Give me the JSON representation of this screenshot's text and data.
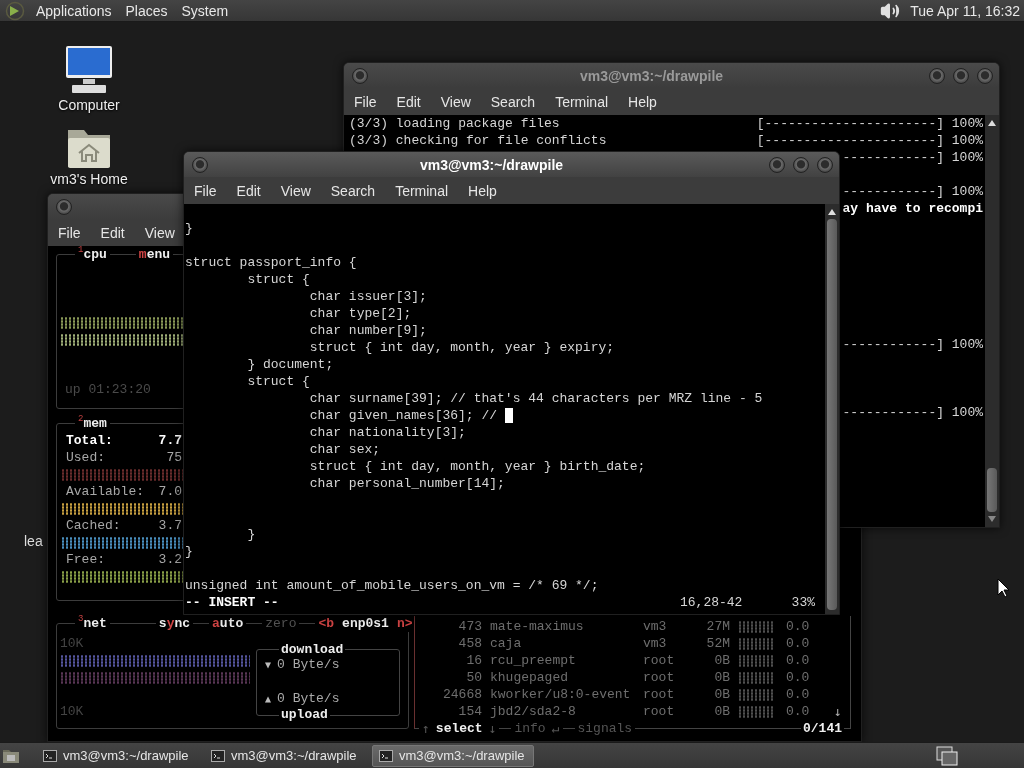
{
  "top_panel": {
    "menus": [
      "Applications",
      "Places",
      "System"
    ],
    "clock": "Tue Apr 11, 16:32"
  },
  "desktop_icons": [
    {
      "kind": "computer",
      "label": "Computer"
    },
    {
      "kind": "home",
      "label": "vm3's Home"
    }
  ],
  "partial_icon_label": "lea",
  "pacman_terminal": {
    "title": "vm3@vm3:~/drawpile",
    "active": false,
    "menus": [
      "File",
      "Edit",
      "View",
      "Search",
      "Terminal",
      "Help"
    ],
    "lines": [
      {
        "kind": "progress",
        "text": "(3/3) loading package files",
        "bar": "[----------------------] 100%"
      },
      {
        "kind": "progress",
        "text": "(3/3) checking for file conflicts",
        "bar": "[----------------------] 100%"
      },
      {
        "kind": "tail",
        "text": "------------] 100%"
      },
      {
        "kind": "blank"
      },
      {
        "kind": "tail",
        "text": "------------] 100%"
      },
      {
        "kind": "message",
        "text": "ay have to recompi"
      },
      {
        "kind": "blank"
      },
      {
        "kind": "blank"
      },
      {
        "kind": "blank"
      },
      {
        "kind": "blank"
      },
      {
        "kind": "blank"
      },
      {
        "kind": "blank"
      },
      {
        "kind": "blank"
      },
      {
        "kind": "tail",
        "text": "------------] 100%"
      },
      {
        "kind": "blank"
      },
      {
        "kind": "blank"
      },
      {
        "kind": "blank"
      },
      {
        "kind": "tail",
        "text": "------------] 100%"
      }
    ]
  },
  "btop_terminal": {
    "active": false,
    "menus": [
      "File",
      "Edit",
      "View"
    ],
    "cpu": {
      "number": "1",
      "title": "cpu",
      "menu_toggle": [
        {
          "text": "m",
          "kind": "hot"
        },
        {
          "text": "enu",
          "kind": "bright"
        }
      ],
      "uptime": "up 01:23:20"
    },
    "mem": {
      "number": "2",
      "title": "mem",
      "rows": [
        {
          "kind": "total",
          "label": "Total:",
          "value": "7.7"
        },
        {
          "kind": "meter",
          "label": "Used:",
          "value": "75",
          "color": "#6a2c2c"
        },
        {
          "kind": "meter",
          "label": "Available:",
          "value": "7.0",
          "color": "#c8a040"
        },
        {
          "kind": "meter",
          "label": "Cached:",
          "value": "3.7",
          "color": "#4a90c0"
        },
        {
          "kind": "meter",
          "label": "Free:",
          "value": "3.2",
          "color": "#8aa048"
        }
      ]
    },
    "net": {
      "number": "3",
      "title": "net",
      "toggles": [
        [
          {
            "text": "s",
            "kind": "bright"
          },
          {
            "text": "y",
            "kind": "hot"
          },
          {
            "text": "nc",
            "kind": "bright"
          }
        ],
        [
          {
            "text": "a",
            "kind": "hot"
          },
          {
            "text": "uto",
            "kind": "bright"
          }
        ],
        [
          {
            "text": "zero",
            "kind": "dim"
          }
        ]
      ],
      "interface": {
        "prev": "<b",
        "name": "enp0s1",
        "next": "n>"
      },
      "scale_top": "10K",
      "scale_bottom": "10K",
      "download": {
        "label": "download",
        "arrow": "▼",
        "rate": "0 Byte/s"
      },
      "upload": {
        "label": "upload",
        "arrow": "▲",
        "rate": "0 Byte/s"
      }
    },
    "processes": {
      "rows": [
        {
          "pid": "473",
          "name": "mate-maximus",
          "user": "vm3",
          "mem": "27M",
          "cpu": "0.0"
        },
        {
          "pid": "458",
          "name": "caja",
          "user": "vm3",
          "mem": "52M",
          "cpu": "0.0"
        },
        {
          "pid": "16",
          "name": "rcu_preempt",
          "user": "root",
          "mem": "0B",
          "cpu": "0.0"
        },
        {
          "pid": "50",
          "name": "khugepaged",
          "user": "root",
          "mem": "0B",
          "cpu": "0.0"
        },
        {
          "pid": "24668",
          "name": "kworker/u8:0-event",
          "user": "root",
          "mem": "0B",
          "cpu": "0.0"
        },
        {
          "pid": "154",
          "name": "jbd2/sda2-8",
          "user": "root",
          "mem": "0B",
          "cpu": "0.0"
        }
      ],
      "scroll_arrow": "↓",
      "footer": [
        [
          {
            "text": "↑",
            "kind": "dim"
          },
          {
            "text": "select",
            "kind": "bright"
          },
          {
            "text": "↓",
            "kind": "dim"
          }
        ],
        [
          {
            "text": "info",
            "kind": "dim"
          },
          {
            "text": "↵",
            "kind": "dim"
          }
        ],
        [
          {
            "text": "signals",
            "kind": "dim"
          }
        ]
      ],
      "count": "0/141"
    }
  },
  "vim_terminal": {
    "title": "vm3@vm3:~/drawpile",
    "active": true,
    "menus": [
      "File",
      "Edit",
      "View",
      "Search",
      "Terminal",
      "Help"
    ],
    "lines": [
      {
        "kind": "code",
        "text": "}",
        "cursor": false
      },
      {
        "kind": "blank"
      },
      {
        "kind": "code",
        "text": "struct passport_info {",
        "cursor": false
      },
      {
        "kind": "code",
        "text": "        struct {",
        "cursor": false
      },
      {
        "kind": "code",
        "text": "                char issuer[3];",
        "cursor": false
      },
      {
        "kind": "code",
        "text": "                char type[2];",
        "cursor": false
      },
      {
        "kind": "code",
        "text": "                char number[9];",
        "cursor": false
      },
      {
        "kind": "code",
        "text": "                struct { int day, month, year } expiry;",
        "cursor": false
      },
      {
        "kind": "code",
        "text": "        } document;",
        "cursor": false
      },
      {
        "kind": "code",
        "text": "        struct {",
        "cursor": false
      },
      {
        "kind": "code",
        "text": "                char surname[39]; // that's 44 characters per MRZ line - 5",
        "cursor": false
      },
      {
        "kind": "code",
        "text": "                char given_names[36]; // ",
        "cursor": true
      },
      {
        "kind": "code",
        "text": "                char nationality[3];",
        "cursor": false
      },
      {
        "kind": "code",
        "text": "                char sex;",
        "cursor": false
      },
      {
        "kind": "code",
        "text": "                struct { int day, month, year } birth_date;",
        "cursor": false
      },
      {
        "kind": "code",
        "text": "                char personal_number[14];",
        "cursor": false
      },
      {
        "kind": "blank"
      },
      {
        "kind": "blank"
      },
      {
        "kind": "code",
        "text": "        }",
        "cursor": false
      },
      {
        "kind": "code",
        "text": "}",
        "cursor": false
      },
      {
        "kind": "blank"
      },
      {
        "kind": "code",
        "text": "unsigned int amount_of_mobile_users_on_vm = /* 69 */;",
        "cursor": false
      }
    ],
    "mode": "-- INSERT --",
    "position": "16,28-42",
    "scroll_percent": "33%"
  },
  "taskbar": {
    "tasks": [
      {
        "label": "vm3@vm3:~/drawpile",
        "selected": false
      },
      {
        "label": "vm3@vm3:~/drawpile",
        "selected": false
      },
      {
        "label": "vm3@vm3:~/drawpile",
        "selected": true
      }
    ]
  }
}
